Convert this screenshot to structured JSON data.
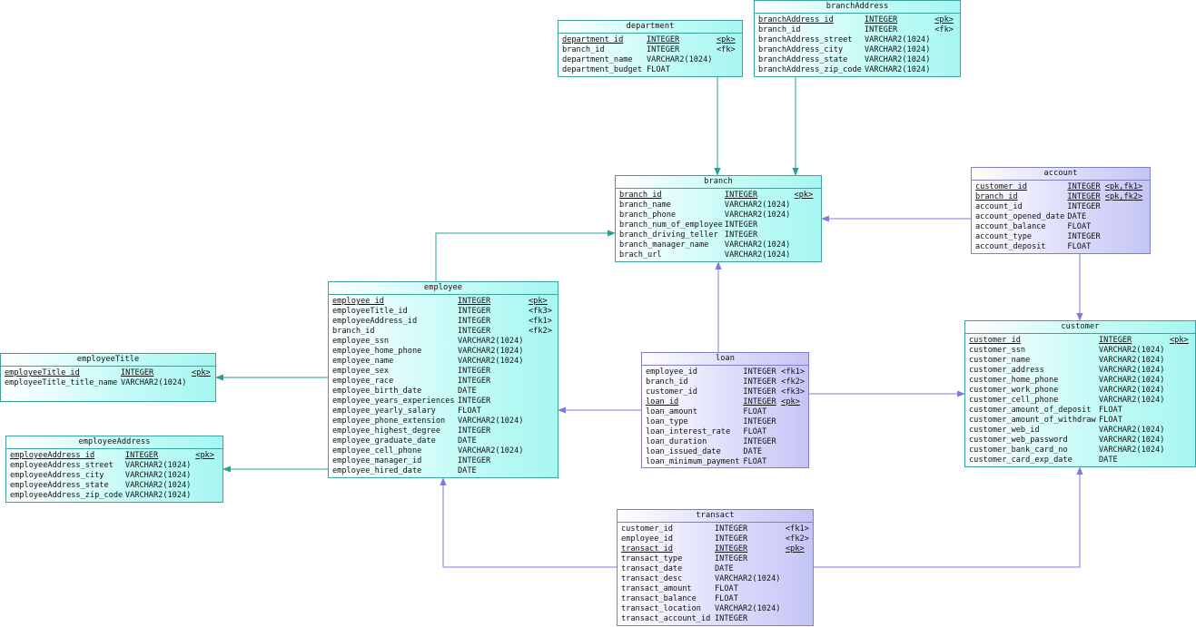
{
  "entities": {
    "department": {
      "title": "department",
      "rows": [
        {
          "name": "department_id",
          "type": "INTEGER",
          "key": "<pk>",
          "pk": true
        },
        {
          "name": "branch_id",
          "type": "INTEGER",
          "key": "<fk>"
        },
        {
          "name": "department_name",
          "type": "VARCHAR2(1024)",
          "key": ""
        },
        {
          "name": "department_budget",
          "type": "FLOAT",
          "key": ""
        }
      ]
    },
    "branchAddress": {
      "title": "branchAddress",
      "rows": [
        {
          "name": "branchAddress_id",
          "type": "INTEGER",
          "key": "<pk>",
          "pk": true
        },
        {
          "name": "branch_id",
          "type": "INTEGER",
          "key": "<fk>"
        },
        {
          "name": "branchAddress_street",
          "type": "VARCHAR2(1024)",
          "key": ""
        },
        {
          "name": "branchAddress_city",
          "type": "VARCHAR2(1024)",
          "key": ""
        },
        {
          "name": "branchAddress_state",
          "type": "VARCHAR2(1024)",
          "key": ""
        },
        {
          "name": "branchAddress_zip_code",
          "type": "VARCHAR2(1024)",
          "key": ""
        }
      ]
    },
    "branch": {
      "title": "branch",
      "rows": [
        {
          "name": "branch_id",
          "type": "INTEGER",
          "key": "<pk>",
          "pk": true
        },
        {
          "name": "branch_name",
          "type": "VARCHAR2(1024)",
          "key": ""
        },
        {
          "name": "branch_phone",
          "type": "VARCHAR2(1024)",
          "key": ""
        },
        {
          "name": "branch_num_of_employee",
          "type": "INTEGER",
          "key": ""
        },
        {
          "name": "branch_driving_teller",
          "type": "INTEGER",
          "key": ""
        },
        {
          "name": "branch_manager_name",
          "type": "VARCHAR2(1024)",
          "key": ""
        },
        {
          "name": "brach_url",
          "type": "VARCHAR2(1024)",
          "key": ""
        }
      ]
    },
    "account": {
      "title": "account",
      "rows": [
        {
          "name": "customer_id",
          "type": "INTEGER",
          "key": "<pk,fk1>",
          "pk": true
        },
        {
          "name": "branch_id",
          "type": "INTEGER",
          "key": "<pk,fk2>",
          "pk": true
        },
        {
          "name": "account_id",
          "type": "INTEGER",
          "key": ""
        },
        {
          "name": "account_opened_date",
          "type": "DATE",
          "key": ""
        },
        {
          "name": "account_balance",
          "type": "FLOAT",
          "key": ""
        },
        {
          "name": "account_type",
          "type": "INTEGER",
          "key": ""
        },
        {
          "name": "account_deposit",
          "type": "FLOAT",
          "key": ""
        }
      ]
    },
    "employee": {
      "title": "employee",
      "rows": [
        {
          "name": "employee_id",
          "type": "INTEGER",
          "key": "<pk>",
          "pk": true
        },
        {
          "name": "employeeTitle_id",
          "type": "INTEGER",
          "key": "<fk3>"
        },
        {
          "name": "employeeAddress_id",
          "type": "INTEGER",
          "key": "<fk1>"
        },
        {
          "name": "branch_id",
          "type": "INTEGER",
          "key": "<fk2>"
        },
        {
          "name": "employee_ssn",
          "type": "VARCHAR2(1024)",
          "key": ""
        },
        {
          "name": "employee_home_phone",
          "type": "VARCHAR2(1024)",
          "key": ""
        },
        {
          "name": "employee_name",
          "type": "VARCHAR2(1024)",
          "key": ""
        },
        {
          "name": "employee_sex",
          "type": "INTEGER",
          "key": ""
        },
        {
          "name": "employee_race",
          "type": "INTEGER",
          "key": ""
        },
        {
          "name": "employee_birth_date",
          "type": "DATE",
          "key": ""
        },
        {
          "name": "employee_years_experiences",
          "type": "INTEGER",
          "key": ""
        },
        {
          "name": "employee_yearly_salary",
          "type": "FLOAT",
          "key": ""
        },
        {
          "name": "employee_phone_extension",
          "type": "VARCHAR2(1024)",
          "key": ""
        },
        {
          "name": "employee_highest_degree",
          "type": "INTEGER",
          "key": ""
        },
        {
          "name": "employee_graduate_date",
          "type": "DATE",
          "key": ""
        },
        {
          "name": "employee_cell_phone",
          "type": "VARCHAR2(1024)",
          "key": ""
        },
        {
          "name": "employee_manager_id",
          "type": "INTEGER",
          "key": ""
        },
        {
          "name": "employee_hired_date",
          "type": "DATE",
          "key": ""
        }
      ]
    },
    "employeeTitle": {
      "title": "employeeTitle",
      "rows": [
        {
          "name": "employeeTitle_id",
          "type": "INTEGER",
          "key": "<pk>",
          "pk": true
        },
        {
          "name": "employeeTitle_title_name",
          "type": "VARCHAR2(1024)",
          "key": ""
        }
      ]
    },
    "employeeAddress": {
      "title": "employeeAddress",
      "rows": [
        {
          "name": "employeeAddress_id",
          "type": "INTEGER",
          "key": "<pk>",
          "pk": true
        },
        {
          "name": "employeeAddress_street",
          "type": "VARCHAR2(1024)",
          "key": ""
        },
        {
          "name": "employeeAddress_city",
          "type": "VARCHAR2(1024)",
          "key": ""
        },
        {
          "name": "employeeAddress_state",
          "type": "VARCHAR2(1024)",
          "key": ""
        },
        {
          "name": "employeeAddress_zip_code",
          "type": "VARCHAR2(1024)",
          "key": ""
        }
      ]
    },
    "loan": {
      "title": "loan",
      "rows": [
        {
          "name": "employee_id",
          "type": "INTEGER",
          "key": "<fk1>"
        },
        {
          "name": "branch_id",
          "type": "INTEGER",
          "key": "<fk2>"
        },
        {
          "name": "customer_id",
          "type": "INTEGER",
          "key": "<fk3>"
        },
        {
          "name": "loan_id",
          "type": "INTEGER",
          "key": "<pk>",
          "pk": true
        },
        {
          "name": "loan_amount",
          "type": "FLOAT",
          "key": ""
        },
        {
          "name": "loan_type",
          "type": "INTEGER",
          "key": ""
        },
        {
          "name": "loan_interest_rate",
          "type": "FLOAT",
          "key": ""
        },
        {
          "name": "loan_duration",
          "type": "INTEGER",
          "key": ""
        },
        {
          "name": "loan_issued_date",
          "type": "DATE",
          "key": ""
        },
        {
          "name": "loan_minimum_payment",
          "type": "FLOAT",
          "key": ""
        }
      ]
    },
    "customer": {
      "title": "customer",
      "rows": [
        {
          "name": "customer_id",
          "type": "INTEGER",
          "key": "<pk>",
          "pk": true
        },
        {
          "name": "customer_ssn",
          "type": "VARCHAR2(1024)",
          "key": ""
        },
        {
          "name": "customer_name",
          "type": "VARCHAR2(1024)",
          "key": ""
        },
        {
          "name": "customer_address",
          "type": "VARCHAR2(1024)",
          "key": ""
        },
        {
          "name": "customer_home_phone",
          "type": "VARCHAR2(1024)",
          "key": ""
        },
        {
          "name": "customer_work_phone",
          "type": "VARCHAR2(1024)",
          "key": ""
        },
        {
          "name": "customer_cell_phone",
          "type": "VARCHAR2(1024)",
          "key": ""
        },
        {
          "name": "customer_amount_of_deposit",
          "type": "FLOAT",
          "key": ""
        },
        {
          "name": "customer_amount_of_withdraw",
          "type": "FLOAT",
          "key": ""
        },
        {
          "name": "customer_web_id",
          "type": "VARCHAR2(1024)",
          "key": ""
        },
        {
          "name": "customer_web_password",
          "type": "VARCHAR2(1024)",
          "key": ""
        },
        {
          "name": "customer_bank_card_no",
          "type": "VARCHAR2(1024)",
          "key": ""
        },
        {
          "name": "customer_card_exp_date",
          "type": "DATE",
          "key": ""
        }
      ]
    },
    "transact": {
      "title": "transact",
      "rows": [
        {
          "name": "customer_id",
          "type": "INTEGER",
          "key": "<fk1>"
        },
        {
          "name": "employee_id",
          "type": "INTEGER",
          "key": "<fk2>"
        },
        {
          "name": "transact_id",
          "type": "INTEGER",
          "key": "<pk>",
          "pk": true
        },
        {
          "name": "transact_type",
          "type": "INTEGER",
          "key": ""
        },
        {
          "name": "transact_date",
          "type": "DATE",
          "key": ""
        },
        {
          "name": "transact_desc",
          "type": "VARCHAR2(1024)",
          "key": ""
        },
        {
          "name": "transact_amount",
          "type": "FLOAT",
          "key": ""
        },
        {
          "name": "transact_balance",
          "type": "FLOAT",
          "key": ""
        },
        {
          "name": "transact_location",
          "type": "VARCHAR2(1024)",
          "key": ""
        },
        {
          "name": "transact_account_id",
          "type": "INTEGER",
          "key": ""
        }
      ]
    }
  },
  "colors": {
    "teal_border": "#3aa39b",
    "violet_border": "#7f7fc9",
    "teal_fill": "#a7f6f1",
    "violet_fill": "#c5c5f5"
  }
}
